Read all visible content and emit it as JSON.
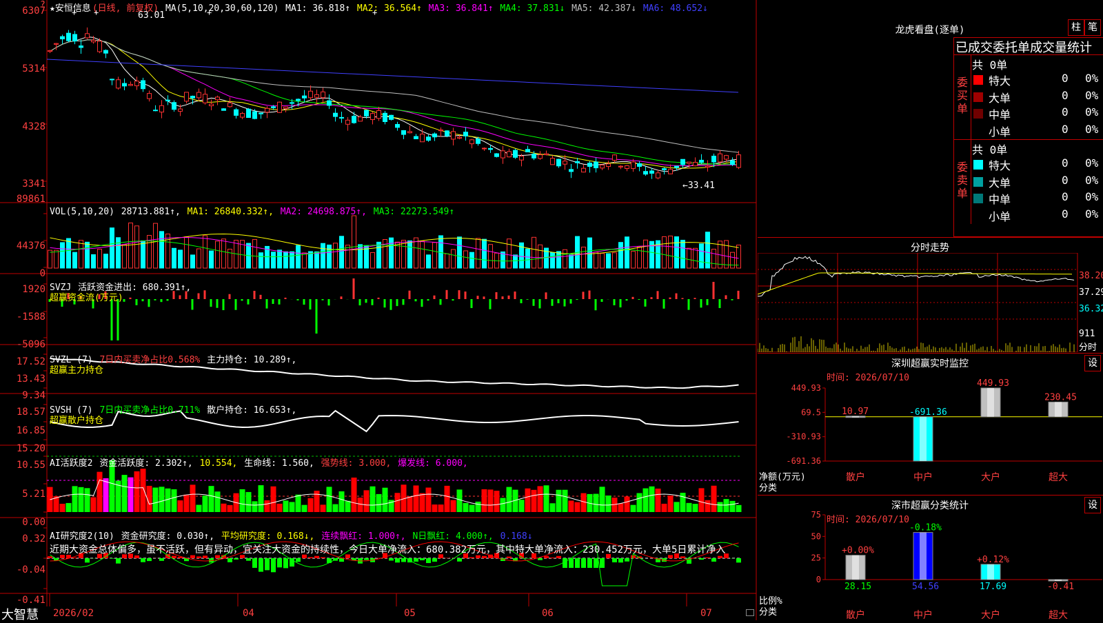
{
  "app": {
    "brand": "大智慧"
  },
  "kline": {
    "title": "★安恒信息",
    "mode": "(日线, 前复权)",
    "ma_label": "MA(5,10,20,30,60,120)",
    "ma": [
      {
        "text": "MA1: 36.818↑",
        "color": "#ffffff"
      },
      {
        "text": "MA2: 36.564↑",
        "color": "#ffff00"
      },
      {
        "text": "MA3: 36.841↑",
        "color": "#ff00ff"
      },
      {
        "text": "MA4: 37.831↓",
        "color": "#00ff00"
      },
      {
        "text": "MA5: 42.387↓",
        "color": "#c0c0c0"
      },
      {
        "text": "MA6: 48.652↓",
        "color": "#4040ff"
      }
    ],
    "y_ticks": [
      "6307",
      "5314",
      "4328",
      "3341"
    ],
    "high_label": "63.01",
    "low_label": "←33.41",
    "corner_mark": "?"
  },
  "vol": {
    "label": "VOL(5,10,20)",
    "value": "28713.881↑,",
    "ma": [
      {
        "text": "MA1: 26840.332↑,",
        "color": "#ffff00"
      },
      {
        "text": "MA2: 24698.875↑,",
        "color": "#ff00ff"
      },
      {
        "text": "MA3: 22273.549↑",
        "color": "#00ff00"
      }
    ],
    "y_ticks": [
      "89861",
      "44376",
      "0"
    ]
  },
  "svzj": {
    "label": "SVZJ",
    "value": "活跃资金进出: 680.391↑,",
    "subtitle": "超赢资金流(万元)",
    "y_ticks": [
      "1920",
      "-1588",
      "-5096"
    ]
  },
  "svzl": {
    "label": "SVZL (7)",
    "ratio": "7日内买卖净占比0.568%",
    "value": "主力持仓: 10.289↑,",
    "subtitle": "超赢主力持仓",
    "y_ticks": [
      "17.52",
      "13.43",
      "9.34"
    ]
  },
  "svsh": {
    "label": "SVSH (7)",
    "ratio": "7日内买卖净占比0.711%",
    "value": "散户持仓: 16.653↑,",
    "subtitle": "超赢散户持仓",
    "y_ticks": [
      "18.57",
      "16.85",
      "15.20"
    ]
  },
  "ai_active": {
    "label": "AI活跃度2",
    "items": [
      {
        "text": "资金活跃度: 2.302↑,",
        "color": "#ffffff"
      },
      {
        "text": "10.554,",
        "color": "#ffff00"
      },
      {
        "text": "生命线: 1.560,",
        "color": "#ffffff"
      },
      {
        "text": "强势线: 3.000,",
        "color": "#ff4040"
      },
      {
        "text": "爆发线: 6.000,",
        "color": "#ff00ff"
      }
    ],
    "y_ticks": [
      "10.55",
      "5.21",
      "0.00"
    ]
  },
  "ai_research": {
    "label": "AI研究度2(10)",
    "items": [
      {
        "text": "资金研究度: 0.030↑,",
        "color": "#ffffff"
      },
      {
        "text": "平均研究度: 0.168↓,",
        "color": "#ffff00"
      },
      {
        "text": "连续飘红: 1.000↑,",
        "color": "#ff00ff"
      },
      {
        "text": "N日飘红: 4.000↑,",
        "color": "#00ff00"
      },
      {
        "text": "0.168↓",
        "color": "#4040ff"
      }
    ],
    "comment": "近期大资金总体偏多，虽不活跃，但有异动，宜关注大资金的持续性，今日大单净流入：680.382万元，其中特大单净流入：230.452万元，大单5日累计净入",
    "y_ticks": [
      "0.32",
      "-0.04",
      "-0.41"
    ]
  },
  "x_axis": [
    "2026/02",
    "04",
    "05",
    "06",
    "07"
  ],
  "lhb": {
    "title": "龙虎看盘(逐单)",
    "buttons": [
      "柱",
      "笔"
    ],
    "tabs": [
      "已成交",
      "委托单",
      "成交量统计"
    ],
    "buy": {
      "side": "委买单",
      "total": "共 0单",
      "rows": [
        {
          "name": "特大",
          "count": "0",
          "pct": "0%",
          "color": "#ff0000"
        },
        {
          "name": "大单",
          "count": "0",
          "pct": "0%",
          "color": "#a00000"
        },
        {
          "name": "中单",
          "count": "0",
          "pct": "0%",
          "color": "#700000"
        },
        {
          "name": "小单",
          "count": "0",
          "pct": "0%",
          "color": ""
        }
      ]
    },
    "sell": {
      "side": "委卖单",
      "total": "共 0单",
      "rows": [
        {
          "name": "特大",
          "count": "0",
          "pct": "0%",
          "color": "#00ffff"
        },
        {
          "name": "大单",
          "count": "0",
          "pct": "0%",
          "color": "#00a0a0"
        },
        {
          "name": "中单",
          "count": "0",
          "pct": "0%",
          "color": "#007878"
        },
        {
          "name": "小单",
          "count": "0",
          "pct": "0%",
          "color": ""
        }
      ]
    }
  },
  "intraday": {
    "title": "分时走势",
    "y_ticks": [
      "38.20",
      "37.29",
      "36.32",
      "911",
      "分时"
    ]
  },
  "monitor": {
    "title": "深圳超赢实时监控",
    "button": "设",
    "time": "时间: 2026/07/10",
    "y_ticks": [
      "449.93",
      "69.5",
      "-310.93",
      "-691.36"
    ],
    "unit": "净额(万元)",
    "cat_label": "分类",
    "categories": [
      "散户",
      "中户",
      "大户",
      "超大"
    ],
    "bar_labels": [
      "10.97",
      "-691.36",
      "449.93",
      "230.45"
    ]
  },
  "classify": {
    "title": "深市超赢分类统计",
    "button": "设",
    "time": "时间: 2026/07/10",
    "y_ticks": [
      "75",
      "50",
      "25",
      "0"
    ],
    "unit": "比例%",
    "cat_label": "分类",
    "categories": [
      "散户",
      "中户",
      "大户",
      "超大"
    ],
    "top_labels": [
      "+0.00%",
      "-0.18%",
      "+0.12%",
      ""
    ],
    "bottom_labels": [
      "28.15",
      "54.56",
      "17.69",
      "-0.41"
    ]
  },
  "chart_data": [
    {
      "type": "bar",
      "title": "深圳超赢实时监控",
      "categories": [
        "散户",
        "中户",
        "大户",
        "超大"
      ],
      "values": [
        10.97,
        -691.36,
        449.93,
        230.45
      ],
      "ylabel": "净额(万元)",
      "ylim": [
        -691.36,
        449.93
      ]
    },
    {
      "type": "bar",
      "title": "深市超赢分类统计",
      "categories": [
        "散户",
        "中户",
        "大户",
        "超大"
      ],
      "values": [
        28.15,
        54.56,
        17.69,
        -0.41
      ],
      "ylabel": "比例%",
      "ylim": [
        0,
        75
      ]
    }
  ]
}
